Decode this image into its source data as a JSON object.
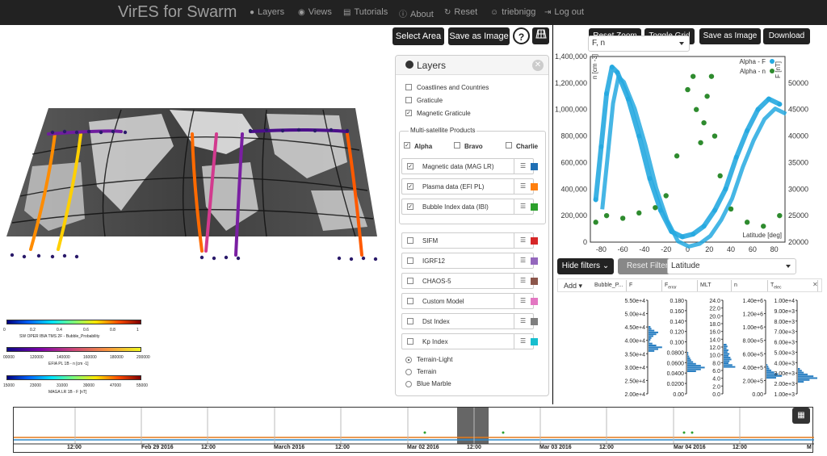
{
  "nav": {
    "brand": "VirES for Swarm",
    "items": [
      {
        "label": "Layers",
        "icon": "globe-icon",
        "glyph": "●"
      },
      {
        "label": "Views",
        "icon": "eye-icon",
        "glyph": "◉"
      },
      {
        "label": "Tutorials",
        "icon": "book-icon",
        "glyph": "▤"
      },
      {
        "label": "About",
        "icon": "info-icon",
        "glyph": "ⓘ"
      },
      {
        "label": "Reset",
        "icon": "refresh-icon",
        "glyph": "↻"
      },
      {
        "label": "triebnigg",
        "icon": "user-icon",
        "glyph": "☺"
      },
      {
        "label": "Log out",
        "icon": "logout-icon",
        "glyph": "⇥"
      }
    ]
  },
  "globe_toolbar": {
    "select_area": "Select Area",
    "save_image": "Save as Image",
    "help": "?"
  },
  "layers": {
    "title": "Layers",
    "base": [
      {
        "label": "Coastlines and Countries",
        "checked": false
      },
      {
        "label": "Graticule",
        "checked": false
      },
      {
        "label": "Magnetic Graticule",
        "checked": true
      }
    ],
    "multi_title": "Multi-satellite Products",
    "satellites": [
      {
        "label": "Alpha",
        "checked": true
      },
      {
        "label": "Bravo",
        "checked": false
      },
      {
        "label": "Charlie",
        "checked": false
      }
    ],
    "products": [
      {
        "label": "Magnetic data (MAG LR)",
        "checked": true,
        "color": "#1f6fb4"
      },
      {
        "label": "Plasma data (EFI PL)",
        "checked": true,
        "color": "#ff7f0e"
      },
      {
        "label": "Bubble Index data (IBI)",
        "checked": true,
        "color": "#2ca02c"
      }
    ],
    "models": [
      {
        "label": "SIFM",
        "checked": false,
        "color": "#d62728"
      },
      {
        "label": "IGRF12",
        "checked": false,
        "color": "#9467bd"
      },
      {
        "label": "CHAOS-5",
        "checked": false,
        "color": "#8c564b"
      },
      {
        "label": "Custom Model",
        "checked": false,
        "color": "#e377c2"
      },
      {
        "label": "Dst Index",
        "checked": false,
        "color": "#7f7f7f"
      },
      {
        "label": "Kp Index",
        "checked": false,
        "color": "#17becf"
      }
    ],
    "basemaps": [
      {
        "label": "Terrain-Light",
        "selected": true
      },
      {
        "label": "Terrain",
        "selected": false
      },
      {
        "label": "Blue Marble",
        "selected": false
      }
    ]
  },
  "colorbars": [
    {
      "title": "SW OPER IBIA TMS 2F - Bubble_Probability",
      "ticks": [
        "0",
        "0.2",
        "0.4",
        "0.6",
        "0.8",
        "1"
      ]
    },
    {
      "title": "EFIA PL 1B - n [cm -1]",
      "ticks": [
        "00000",
        "120000",
        "140000",
        "160000",
        "180000",
        "200000"
      ]
    },
    {
      "title": "MAGA LR 1B - F [nT]",
      "ticks": [
        "15000",
        "23000",
        "31000",
        "39000",
        "47000",
        "55000"
      ]
    }
  ],
  "plot_toolbar": {
    "reset_zoom": "Reset Zoom",
    "toggle_grid": "Toggle Grid",
    "save_image": "Save as Image",
    "download": "Download",
    "y_select": "F, n"
  },
  "chart_data": {
    "type": "scatter",
    "xlabel": "Latitude [deg]",
    "ylabel": "n [cm -3]",
    "y2label": "F [nT]",
    "xlim": [
      -90,
      90
    ],
    "ylim": [
      0,
      1400000
    ],
    "y2lim": [
      20000,
      55000
    ],
    "x_ticks": [
      "-80",
      "-60",
      "-40",
      "-20",
      "0",
      "20",
      "40",
      "60",
      "80"
    ],
    "y_ticks": [
      "0",
      "200,000",
      "400,000",
      "600,000",
      "800,000",
      "1,000,000",
      "1,200,000",
      "1,400,000"
    ],
    "y2_ticks": [
      "20000",
      "25000",
      "30000",
      "35000",
      "40000",
      "45000",
      "50000"
    ],
    "legend_position": "top-right",
    "grid": false,
    "series": [
      {
        "name": "Alpha - F",
        "color": "#26a9e0",
        "axis": "right",
        "points": [
          [
            -85,
            28000
          ],
          [
            -80,
            38000
          ],
          [
            -75,
            48000
          ],
          [
            -70,
            53000
          ],
          [
            -65,
            52000
          ],
          [
            -55,
            47000
          ],
          [
            -45,
            40000
          ],
          [
            -35,
            32000
          ],
          [
            -25,
            26000
          ],
          [
            -15,
            22000
          ],
          [
            -5,
            21000
          ],
          [
            5,
            21500
          ],
          [
            15,
            23000
          ],
          [
            25,
            26000
          ],
          [
            35,
            30000
          ],
          [
            45,
            36000
          ],
          [
            55,
            41000
          ],
          [
            65,
            45000
          ],
          [
            75,
            47000
          ],
          [
            85,
            46000
          ]
        ]
      },
      {
        "name": "Alpha - n",
        "color": "#2e8b2e",
        "axis": "left",
        "points": [
          [
            -85,
            150000
          ],
          [
            -75,
            200000
          ],
          [
            -60,
            180000
          ],
          [
            -45,
            220000
          ],
          [
            -30,
            260000
          ],
          [
            -20,
            350000
          ],
          [
            -10,
            650000
          ],
          [
            0,
            1150000
          ],
          [
            5,
            1250000
          ],
          [
            8,
            1000000
          ],
          [
            12,
            750000
          ],
          [
            15,
            900000
          ],
          [
            18,
            1100000
          ],
          [
            22,
            1250000
          ],
          [
            25,
            800000
          ],
          [
            30,
            500000
          ],
          [
            40,
            250000
          ],
          [
            55,
            150000
          ],
          [
            70,
            120000
          ],
          [
            85,
            200000
          ]
        ]
      }
    ]
  },
  "filters": {
    "hide_filters": "Hide filters",
    "reset_filters": "Reset Filters",
    "field_select": "Latitude",
    "add": "Add",
    "tags": [
      "Bubble_P...",
      "F",
      "F",
      "MLT",
      "n",
      "T"
    ],
    "tag_subs": [
      "",
      "",
      "error",
      "",
      "",
      "elec"
    ],
    "axes": [
      {
        "ticks": [
          "5.50e+4",
          "5.00e+4",
          "4.50e+4",
          "4.00e+4",
          "3.50e+4",
          "3.00e+4",
          "2.50e+4",
          "2.00e+4"
        ]
      },
      {
        "ticks": [
          "0.180",
          "0.160",
          "0.140",
          "0.120",
          "0.100",
          "0.0800",
          "0.0600",
          "0.0400",
          "0.0200",
          "0.00"
        ]
      },
      {
        "ticks": [
          "24.0",
          "22.0",
          "20.0",
          "18.0",
          "16.0",
          "14.0",
          "12.0",
          "10.0",
          "8.0",
          "6.0",
          "4.0",
          "2.0",
          "0.0"
        ]
      },
      {
        "ticks": [
          "1.40e+6",
          "1.20e+6",
          "1.00e+6",
          "8.00e+5",
          "6.00e+5",
          "4.00e+5",
          "2.00e+5",
          "0.00"
        ]
      },
      {
        "ticks": [
          "1.00e+4",
          "9.00e+3",
          "8.00e+3",
          "7.00e+3",
          "6.00e+3",
          "5.00e+3",
          "4.00e+3",
          "3.00e+3",
          "2.00e+3",
          "1.00e+3"
        ]
      }
    ]
  },
  "timeline": {
    "labels": [
      "12:00",
      "Feb 29 2016",
      "12:00",
      "March 2016",
      "12:00",
      "Mar 02 2016",
      "12:00",
      "Mar 03 2016",
      "12:00",
      "Mar 04 2016",
      "12:00",
      "M"
    ]
  }
}
